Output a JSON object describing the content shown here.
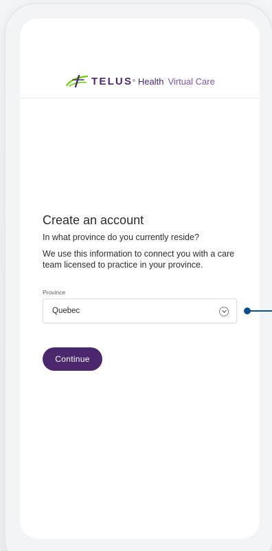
{
  "brand": {
    "telus": "TELUS",
    "registered": "®",
    "health": "Health",
    "product": "Virtual Care"
  },
  "form": {
    "title": "Create an account",
    "question": "In what province do you currently reside?",
    "info": "We use this information to connect you with a care team licensed to practice in your province.",
    "province": {
      "label": "Province",
      "value": "Quebec"
    },
    "continue_label": "Continue"
  },
  "colors": {
    "brand_purple": "#4b286d",
    "brand_green": "#66cc00",
    "callout_blue": "#0b4f8a"
  },
  "icons": {
    "logo": "telus-leaf-icon",
    "dropdown": "chevron-down-icon"
  }
}
